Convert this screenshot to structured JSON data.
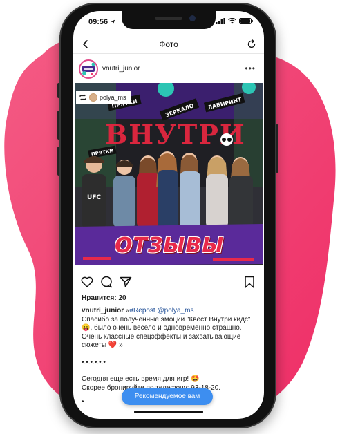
{
  "status_bar": {
    "time": "09:56"
  },
  "nav": {
    "title": "Фото"
  },
  "post": {
    "username": "vnutri_junior",
    "avatar_text": "ВНУТРИ",
    "more_label": "•••",
    "repost_user": "polya_ms",
    "photo_overlay_text": "ОТЗЫВЫ",
    "sign_text": "ВНУТРИ",
    "banner_words": [
      "ПРЯТКИ",
      "ЗЕРКАЛО",
      "ЛАБИРИНТ"
    ],
    "shirt_text": "UFC",
    "likes": "Нравится: 20",
    "caption": {
      "user": "vnutri_junior",
      "prefix": " «",
      "tag": "#Repost",
      "mention": "@polya_ms",
      "line1": "Спасибо за полученные эмоции \"Квест Внутри кидс\" 😛, было очень весело и одновременно страшно. Очень классные спецэффекты и захватывающие сюжеты ❤️ »",
      "dots": "•.•.•.•.•.•",
      "line2": "Сегодня еще есть время для игр! 🤩",
      "line3": "Скорее бронируйте по телефону: 93-18-20.",
      "trailing": "•"
    }
  },
  "recommend_label": "Рекомендуемое вам",
  "colors": {
    "blob": "#f23a6f",
    "link": "#1f4e96",
    "button": "#3d8ef0",
    "accent_purple": "#5a2a9a",
    "accent_teal": "#2cc5b4"
  }
}
